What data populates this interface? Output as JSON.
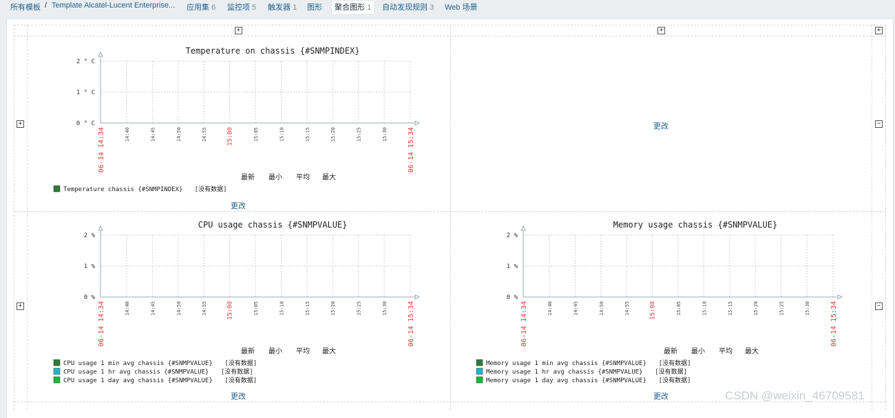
{
  "breadcrumb": {
    "all_templates": "所有模板",
    "separator": "/",
    "template_name": "Template Alcatel-Lucent Enterprise..."
  },
  "tabs": [
    {
      "label": "应用集",
      "count": "6"
    },
    {
      "label": "监控项",
      "count": "5"
    },
    {
      "label": "触发器",
      "count": "1"
    },
    {
      "label": "图形",
      "count": ""
    },
    {
      "label": "聚合图形",
      "count": "1"
    },
    {
      "label": "自动发现规则",
      "count": "3"
    },
    {
      "label": "Web 场景",
      "count": ""
    }
  ],
  "screen": {
    "change_label": "更改",
    "legend_headers": [
      "最新",
      "最小",
      "平均",
      "最大"
    ],
    "no_data": "[没有数据]"
  },
  "colors": {
    "series": [
      "#2e7d32",
      "#26b5c8",
      "#1fb53a"
    ],
    "time_red": "#e53935",
    "link": "#1f5f8b"
  },
  "x_ticks": [
    "14:40",
    "14:45",
    "14:50",
    "14:55",
    "15:00",
    "15:05",
    "15:10",
    "15:15",
    "15:20",
    "15:25",
    "15:30"
  ],
  "x_ends": [
    "06-14 14:34",
    "06-14 15:34"
  ],
  "chart_data": [
    {
      "type": "line",
      "title": "Temperature on chassis {#SNMPINDEX}",
      "ylabel": "",
      "y_ticks": [
        "2 ° C",
        "1 ° C",
        "0 ° C"
      ],
      "ylim": [
        0,
        2
      ],
      "series": [
        {
          "name": "Temperature chassis {#SNMPINDEX}",
          "values": []
        }
      ]
    },
    {
      "type": "line",
      "title": "CPU usage chassis {#SNMPVALUE}",
      "ylabel": "",
      "y_ticks": [
        "2 %",
        "1 %",
        "0 %"
      ],
      "ylim": [
        0,
        2
      ],
      "series": [
        {
          "name": "CPU usage 1 min avg chassis {#SNMPVALUE}",
          "values": []
        },
        {
          "name": "CPU usage 1 hr avg chassis {#SNMPVALUE}",
          "values": []
        },
        {
          "name": "CPU usage 1 day avg chassis {#SNMPVALUE}",
          "values": []
        }
      ]
    },
    {
      "type": "line",
      "title": "Memory usage chassis {#SNMPVALUE}",
      "ylabel": "",
      "y_ticks": [
        "2 %",
        "1 %",
        "0 %"
      ],
      "ylim": [
        0,
        2
      ],
      "series": [
        {
          "name": "Memory usage 1 min avg chassis {#SNMPVALUE}",
          "values": []
        },
        {
          "name": "Memory usage 1 hr avg chassis {#SNMPVALUE}",
          "values": []
        },
        {
          "name": "Memory usage 1 day avg chassis {#SNMPVALUE}",
          "values": []
        }
      ]
    }
  ],
  "watermark": "CSDN @weixin_46709581"
}
